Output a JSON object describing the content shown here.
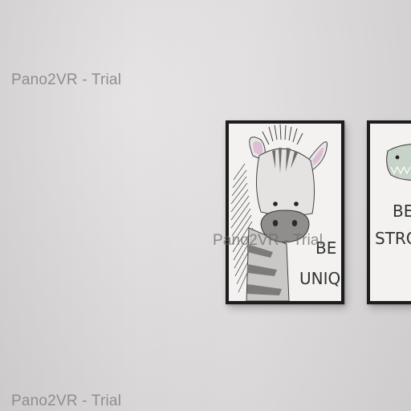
{
  "watermarks": [
    "Pano2VR - Trial",
    "Pano2VR - Trial",
    "Pano2VR - Trial"
  ],
  "posters": [
    {
      "subject": "zebra",
      "text_line1": "BE",
      "text_line2": "UNIQU"
    },
    {
      "subject": "dinosaur",
      "text_line1": "BE",
      "text_line2": "STRON"
    }
  ],
  "colors": {
    "wall": "#dddbdb",
    "frame": "#1d1d1d",
    "mat": "#f3f2f0",
    "zebra_gray": "#8f8e8d",
    "dino_green": "#c7d3c8",
    "ear_pink": "#dcbfd3"
  }
}
